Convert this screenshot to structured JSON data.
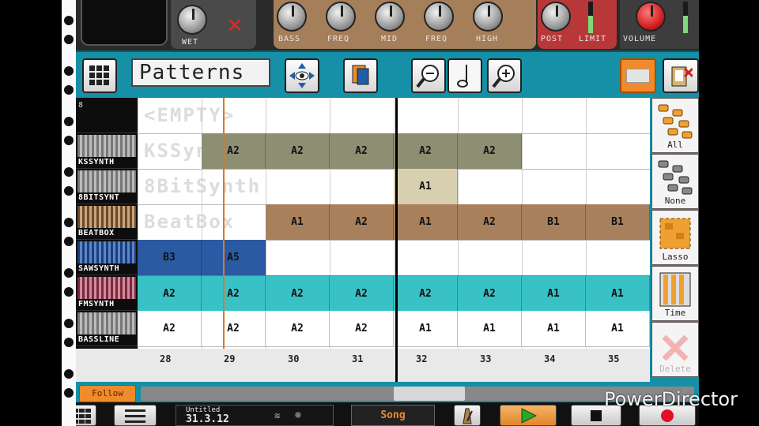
{
  "fx": {
    "knobs": [
      {
        "label": "WET"
      },
      {
        "label": "BASS"
      },
      {
        "label": "FREQ"
      },
      {
        "label": "MID"
      },
      {
        "label": "FREQ"
      },
      {
        "label": "HIGH"
      },
      {
        "label": "POST"
      },
      {
        "label": "LIMIT"
      },
      {
        "label": "VOLUME"
      }
    ]
  },
  "toolbar": {
    "mode_label": "Patterns"
  },
  "tracks": [
    {
      "name": "",
      "ghost": "<EMPTY>",
      "color": "#ffffff"
    },
    {
      "name": "KSSYNTH",
      "ghost": "KSSyn",
      "color": "#8e8e72"
    },
    {
      "name": "8BITSYNT",
      "ghost": "8BitSynth",
      "color": "#d8cfae"
    },
    {
      "name": "BEATBOX",
      "ghost": "BeatBox",
      "color": "#a9805c"
    },
    {
      "name": "SAWSYNTH",
      "ghost": "",
      "color": "#2c5aa2"
    },
    {
      "name": "FMSYNTH",
      "ghost": "",
      "color": "#39c2c6"
    },
    {
      "name": "BASSLINE",
      "ghost": "",
      "color": "#ffffff"
    }
  ],
  "header_corner": "8",
  "clips": [
    {
      "row": 1,
      "col": 1,
      "label": "A2",
      "style": "olive"
    },
    {
      "row": 1,
      "col": 2,
      "label": "A2",
      "style": "olive"
    },
    {
      "row": 1,
      "col": 3,
      "label": "A2",
      "style": "olive"
    },
    {
      "row": 1,
      "col": 4,
      "label": "A2",
      "style": "olive"
    },
    {
      "row": 1,
      "col": 5,
      "label": "A2",
      "style": "olive"
    },
    {
      "row": 2,
      "col": 4,
      "label": "A1",
      "style": "tan"
    },
    {
      "row": 3,
      "col": 2,
      "label": "A1",
      "style": "brown"
    },
    {
      "row": 3,
      "col": 3,
      "label": "A2",
      "style": "brown"
    },
    {
      "row": 3,
      "col": 4,
      "label": "A1",
      "style": "brown"
    },
    {
      "row": 3,
      "col": 5,
      "label": "A2",
      "style": "brown"
    },
    {
      "row": 3,
      "col": 6,
      "label": "B1",
      "style": "brown"
    },
    {
      "row": 3,
      "col": 7,
      "label": "B1",
      "style": "brown"
    },
    {
      "row": 4,
      "col": 0,
      "label": "B3",
      "style": "blue"
    },
    {
      "row": 4,
      "col": 1,
      "label": "A5",
      "style": "blue"
    },
    {
      "row": 5,
      "col": 0,
      "label": "A2",
      "style": "teal"
    },
    {
      "row": 5,
      "col": 1,
      "label": "A2",
      "style": "teal"
    },
    {
      "row": 5,
      "col": 2,
      "label": "A2",
      "style": "teal"
    },
    {
      "row": 5,
      "col": 3,
      "label": "A2",
      "style": "teal"
    },
    {
      "row": 5,
      "col": 4,
      "label": "A2",
      "style": "teal"
    },
    {
      "row": 5,
      "col": 5,
      "label": "A2",
      "style": "teal"
    },
    {
      "row": 5,
      "col": 6,
      "label": "A1",
      "style": "teal"
    },
    {
      "row": 5,
      "col": 7,
      "label": "A1",
      "style": "teal"
    },
    {
      "row": 6,
      "col": 0,
      "label": "A2",
      "style": "white"
    },
    {
      "row": 6,
      "col": 1,
      "label": "A2",
      "style": "white"
    },
    {
      "row": 6,
      "col": 2,
      "label": "A2",
      "style": "white"
    },
    {
      "row": 6,
      "col": 3,
      "label": "A2",
      "style": "white"
    },
    {
      "row": 6,
      "col": 4,
      "label": "A1",
      "style": "white"
    },
    {
      "row": 6,
      "col": 5,
      "label": "A1",
      "style": "white"
    },
    {
      "row": 6,
      "col": 6,
      "label": "A1",
      "style": "white"
    },
    {
      "row": 6,
      "col": 7,
      "label": "A1",
      "style": "white"
    }
  ],
  "ruler": [
    "28",
    "29",
    "30",
    "31",
    "32",
    "33",
    "34",
    "35"
  ],
  "select_tools": [
    {
      "label": "All"
    },
    {
      "label": "None"
    },
    {
      "label": "Lasso"
    },
    {
      "label": "Time"
    },
    {
      "label": "Delete"
    }
  ],
  "follow_label": "Follow",
  "transport": {
    "song_title": "Untitled",
    "position": "31.3.12",
    "mode_label": "Song"
  },
  "watermark": "PowerDirector",
  "colors": {
    "toolbar": "#1590a6",
    "accent": "#f08a2a",
    "post_section": "#b8383a",
    "eq_section": "#a57e5a"
  }
}
